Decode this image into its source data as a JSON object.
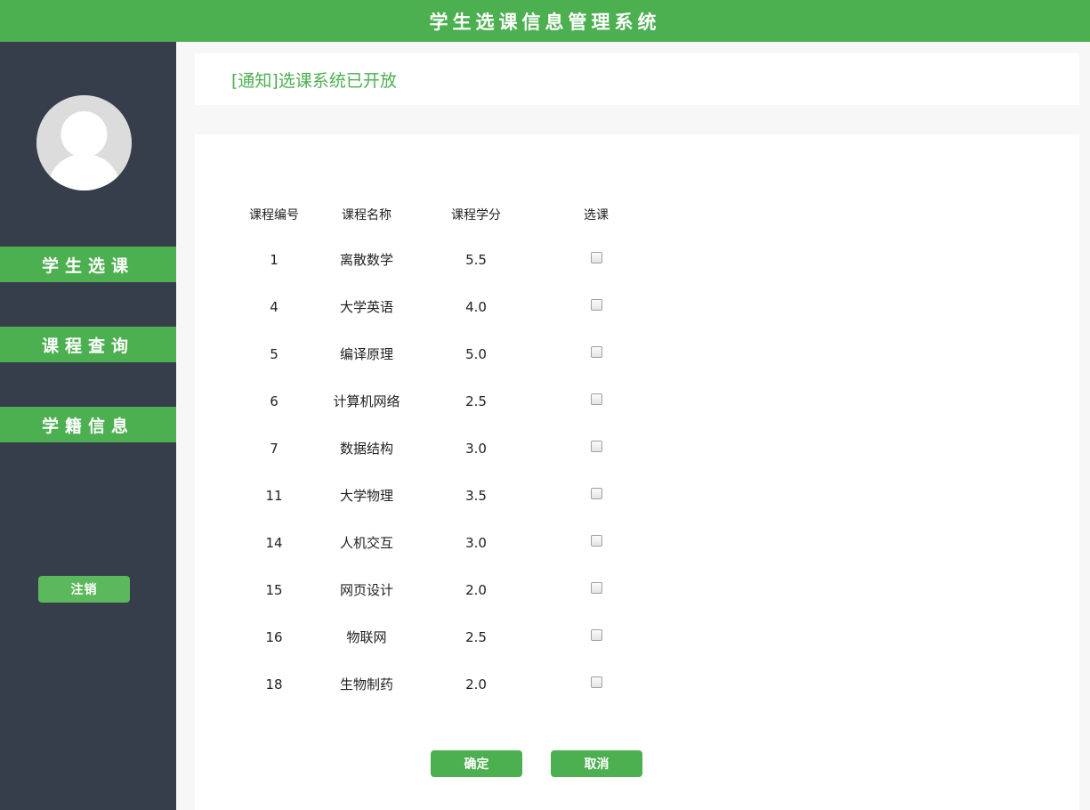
{
  "header": {
    "title": "学生选课信息管理系统"
  },
  "sidebar": {
    "avatar_icon": "user-avatar-icon",
    "items": [
      {
        "label": "学生选课"
      },
      {
        "label": "课程查询"
      },
      {
        "label": "学籍信息"
      }
    ],
    "logout_label": "注销"
  },
  "notice": {
    "text": "[通知]选课系统已开放"
  },
  "table": {
    "headers": {
      "id": "课程编号",
      "name": "课程名称",
      "credit": "课程学分",
      "select": "选课"
    },
    "rows": [
      {
        "id": "1",
        "name": "离散数学",
        "credit": "5.5",
        "checked": false
      },
      {
        "id": "4",
        "name": "大学英语",
        "credit": "4.0",
        "checked": false
      },
      {
        "id": "5",
        "name": "编译原理",
        "credit": "5.0",
        "checked": false
      },
      {
        "id": "6",
        "name": "计算机网络",
        "credit": "2.5",
        "checked": false
      },
      {
        "id": "7",
        "name": "数据结构",
        "credit": "3.0",
        "checked": false
      },
      {
        "id": "11",
        "name": "大学物理",
        "credit": "3.5",
        "checked": false
      },
      {
        "id": "14",
        "name": "人机交互",
        "credit": "3.0",
        "checked": false
      },
      {
        "id": "15",
        "name": "网页设计",
        "credit": "2.0",
        "checked": false
      },
      {
        "id": "16",
        "name": "物联网",
        "credit": "2.5",
        "checked": false
      },
      {
        "id": "18",
        "name": "生物制药",
        "credit": "2.0",
        "checked": false
      }
    ]
  },
  "actions": {
    "confirm_label": "确定",
    "cancel_label": "取消"
  },
  "colors": {
    "accent": "#4caf50",
    "sidebar_bg": "#373e4b"
  }
}
